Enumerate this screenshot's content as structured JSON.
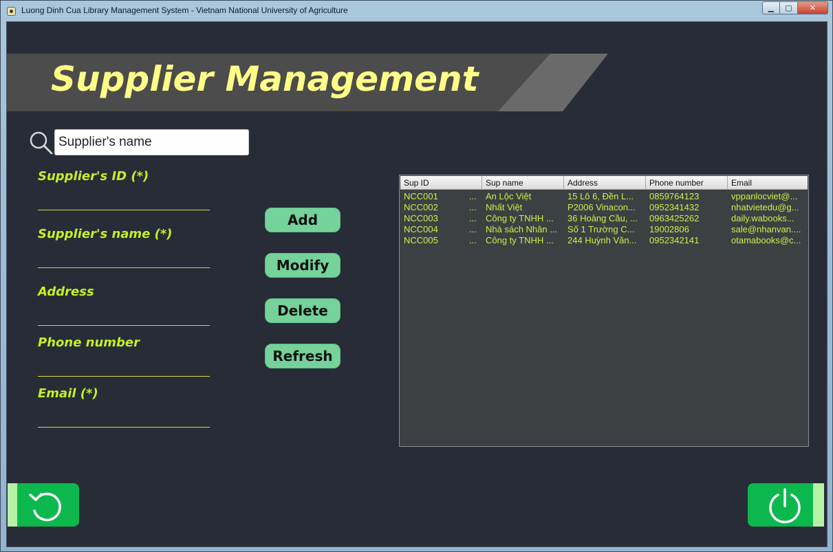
{
  "window": {
    "title": "Luong Dinh Cua Library Management System - Vietnam National University of Agriculture",
    "min_glyph": "▁",
    "max_glyph": "▢",
    "close_glyph": "✕"
  },
  "header": {
    "title": "Supplier Management"
  },
  "search": {
    "value": "Supplier's name",
    "icon": "search-icon"
  },
  "form": {
    "supplier_id_label": "Supplier's ID (*)",
    "supplier_name_label": "Supplier's name  (*)",
    "address_label": "Address",
    "phone_label": "Phone number",
    "email_label": "Email (*)"
  },
  "actions": {
    "add": "Add",
    "modify": "Modify",
    "delete": "Delete",
    "refresh": "Refresh"
  },
  "table": {
    "columns": [
      "Sup ID",
      "Sup name",
      "Address",
      "Phone number",
      "Email"
    ],
    "rows": [
      [
        "NCC001",
        "...",
        "An Lộc Việt",
        "15 Lô 6, Đền L...",
        "0859764123",
        "vppanlocviet@..."
      ],
      [
        "NCC002",
        "...",
        "Nhất Việt",
        "P2006 Vinacon...",
        "0952341432",
        "nhatvietedu@g..."
      ],
      [
        "NCC003",
        "...",
        "Công ty TNHH ...",
        "36 Hoàng Cầu, ...",
        "0963425262",
        "daily.wabooks..."
      ],
      [
        "NCC004",
        "...",
        "Nhà sách Nhân ...",
        "Số 1 Trường C...",
        "19002806",
        "sale@nhanvan...."
      ],
      [
        "NCC005",
        "...",
        "Công ty TNHH ...",
        "244 Huỳnh Văn...",
        "0952342141",
        "otamabooks@c..."
      ]
    ]
  },
  "bottom": {
    "back_icon": "undo-icon",
    "power_icon": "power-icon"
  },
  "colors": {
    "background": "#282c36",
    "title": "#ffff88",
    "label": "#c4f028",
    "button": "#74d29a",
    "bottom_button": "#0cb84e",
    "table_text": "#c6f24a"
  }
}
